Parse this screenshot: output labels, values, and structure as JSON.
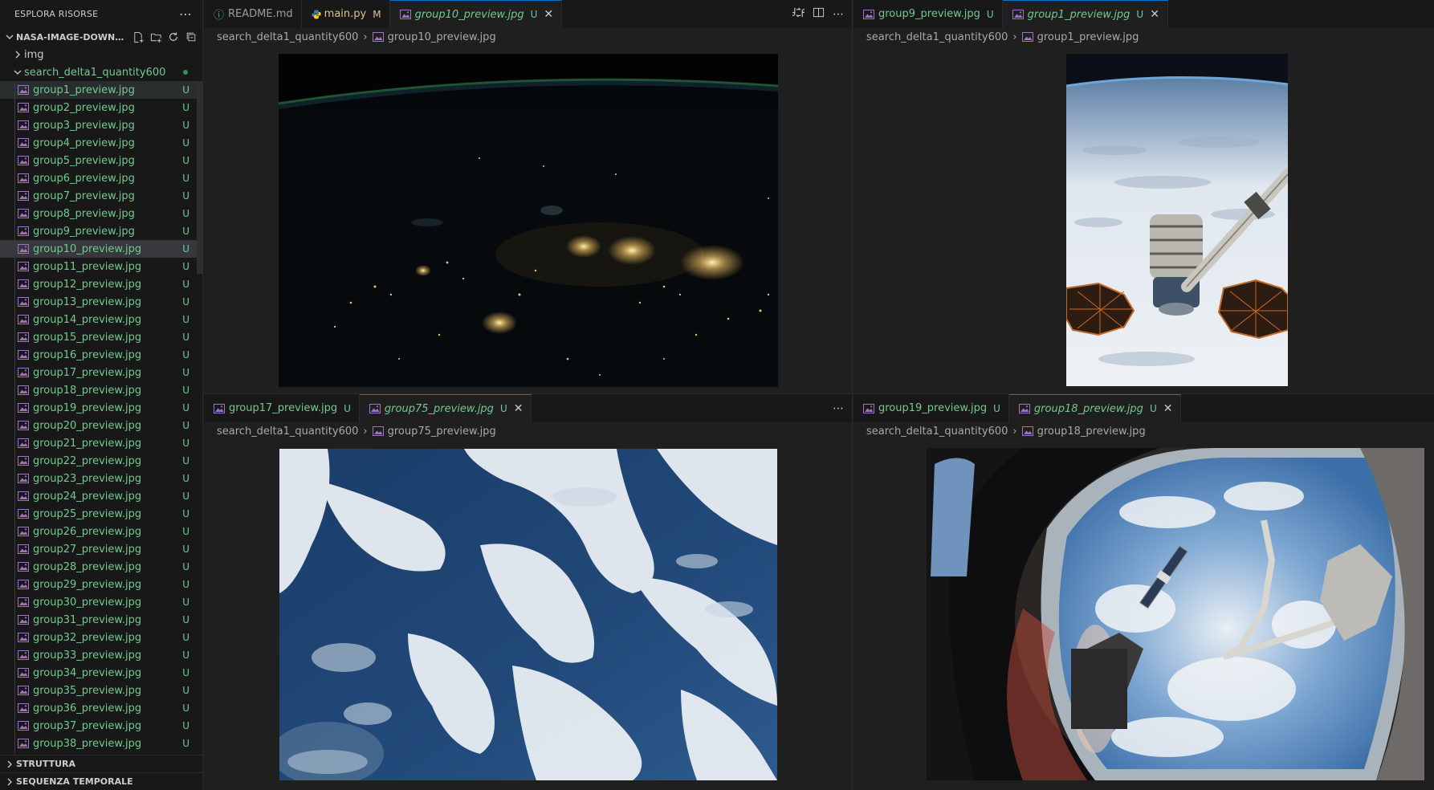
{
  "explorer": {
    "title": "ESPLORA RISORSE",
    "more_icon": "ellipsis-icon",
    "root_folder": "NASA-IMAGE-DOWNLO...",
    "actions": [
      "new-file-icon",
      "new-folder-icon",
      "refresh-icon",
      "collapse-all-icon"
    ],
    "folders": [
      {
        "name": "img",
        "expanded": false
      },
      {
        "name": "search_delta1_quantity600",
        "expanded": true
      }
    ],
    "files": [
      {
        "name": "group1_preview.jpg",
        "status": "U"
      },
      {
        "name": "group2_preview.jpg",
        "status": "U"
      },
      {
        "name": "group3_preview.jpg",
        "status": "U"
      },
      {
        "name": "group4_preview.jpg",
        "status": "U"
      },
      {
        "name": "group5_preview.jpg",
        "status": "U"
      },
      {
        "name": "group6_preview.jpg",
        "status": "U"
      },
      {
        "name": "group7_preview.jpg",
        "status": "U"
      },
      {
        "name": "group8_preview.jpg",
        "status": "U"
      },
      {
        "name": "group9_preview.jpg",
        "status": "U"
      },
      {
        "name": "group10_preview.jpg",
        "status": "U"
      },
      {
        "name": "group11_preview.jpg",
        "status": "U"
      },
      {
        "name": "group12_preview.jpg",
        "status": "U"
      },
      {
        "name": "group13_preview.jpg",
        "status": "U"
      },
      {
        "name": "group14_preview.jpg",
        "status": "U"
      },
      {
        "name": "group15_preview.jpg",
        "status": "U"
      },
      {
        "name": "group16_preview.jpg",
        "status": "U"
      },
      {
        "name": "group17_preview.jpg",
        "status": "U"
      },
      {
        "name": "group18_preview.jpg",
        "status": "U"
      },
      {
        "name": "group19_preview.jpg",
        "status": "U"
      },
      {
        "name": "group20_preview.jpg",
        "status": "U"
      },
      {
        "name": "group21_preview.jpg",
        "status": "U"
      },
      {
        "name": "group22_preview.jpg",
        "status": "U"
      },
      {
        "name": "group23_preview.jpg",
        "status": "U"
      },
      {
        "name": "group24_preview.jpg",
        "status": "U"
      },
      {
        "name": "group25_preview.jpg",
        "status": "U"
      },
      {
        "name": "group26_preview.jpg",
        "status": "U"
      },
      {
        "name": "group27_preview.jpg",
        "status": "U"
      },
      {
        "name": "group28_preview.jpg",
        "status": "U"
      },
      {
        "name": "group29_preview.jpg",
        "status": "U"
      },
      {
        "name": "group30_preview.jpg",
        "status": "U"
      },
      {
        "name": "group31_preview.jpg",
        "status": "U"
      },
      {
        "name": "group32_preview.jpg",
        "status": "U"
      },
      {
        "name": "group33_preview.jpg",
        "status": "U"
      },
      {
        "name": "group34_preview.jpg",
        "status": "U"
      },
      {
        "name": "group35_preview.jpg",
        "status": "U"
      },
      {
        "name": "group36_preview.jpg",
        "status": "U"
      },
      {
        "name": "group37_preview.jpg",
        "status": "U"
      },
      {
        "name": "group38_preview.jpg",
        "status": "U"
      }
    ],
    "sections": [
      "STRUTTURA",
      "SEQUENZA TEMPORALE"
    ]
  },
  "editor_groups": {
    "top_left": {
      "tabs": [
        {
          "label": "README.md",
          "status": "",
          "icon": "markdown-info-icon"
        },
        {
          "label": "main.py",
          "status": "M",
          "icon": "python-icon"
        },
        {
          "label": "group10_preview.jpg",
          "status": "U",
          "icon": "image-file-icon"
        }
      ],
      "actions": [
        "compare-changes-icon",
        "split-editor-icon",
        "ellipsis-icon"
      ],
      "breadcrumb": {
        "folder": "search_delta1_quantity600",
        "file": "group10_preview.jpg"
      }
    },
    "top_right": {
      "tabs": [
        {
          "label": "group9_preview.jpg",
          "status": "U"
        },
        {
          "label": "group1_preview.jpg",
          "status": "U"
        }
      ],
      "breadcrumb": {
        "folder": "search_delta1_quantity600",
        "file": "group1_preview.jpg"
      }
    },
    "bottom_left": {
      "tabs": [
        {
          "label": "group17_preview.jpg",
          "status": "U"
        },
        {
          "label": "group75_preview.jpg",
          "status": "U"
        }
      ],
      "actions": [
        "ellipsis-icon"
      ],
      "breadcrumb": {
        "folder": "search_delta1_quantity600",
        "file": "group75_preview.jpg"
      }
    },
    "bottom_right": {
      "tabs": [
        {
          "label": "group19_preview.jpg",
          "status": "U"
        },
        {
          "label": "group18_preview.jpg",
          "status": "U"
        }
      ],
      "breadcrumb": {
        "folder": "search_delta1_quantity600",
        "file": "group18_preview.jpg"
      }
    }
  },
  "colors": {
    "untracked_green": "#73c991",
    "modified_yellow": "#e2c08d",
    "accent_blue": "#0078d4",
    "image_icon_purple": "#a074c4"
  }
}
